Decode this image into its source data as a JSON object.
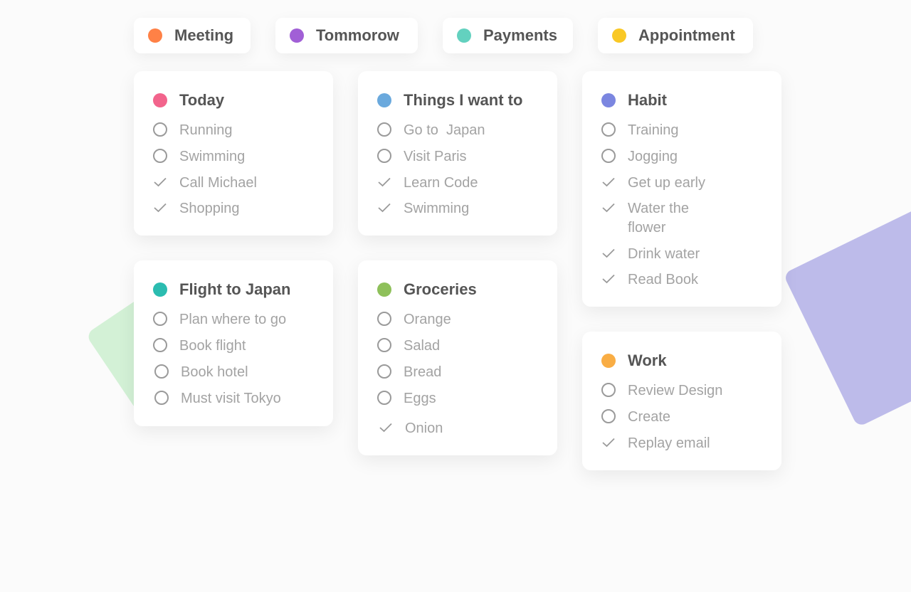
{
  "colors": {
    "orange": "#ff8146",
    "purple": "#a15fd6",
    "teal": "#63d1bf",
    "yellow": "#f9c825",
    "pink": "#f2648c",
    "blue": "#6aa9dd",
    "indigo": "#7b86e0",
    "cyan": "#2bbcb0",
    "green": "#8ec05a",
    "amber": "#f9ad44",
    "deco_green": "#d3f1d6",
    "deco_purple": "#bdbbea"
  },
  "tags": [
    {
      "label": "Meeting"
    },
    {
      "label": "Tommorow"
    },
    {
      "label": "Payments"
    },
    {
      "label": "Appointment"
    }
  ],
  "lists": {
    "today": {
      "title": "Today",
      "items": [
        {
          "text": "Running",
          "done": false
        },
        {
          "text": "Swimming",
          "done": false
        },
        {
          "text": "Call Michael",
          "done": true
        },
        {
          "text": "Shopping",
          "done": true
        }
      ]
    },
    "things": {
      "title": "Things I want to",
      "items": [
        {
          "text": "Go to  Japan",
          "done": false
        },
        {
          "text": "Visit Paris",
          "done": false
        },
        {
          "text": "Learn Code",
          "done": true
        },
        {
          "text": "Swimming",
          "done": true
        }
      ]
    },
    "habit": {
      "title": "Habit",
      "items": [
        {
          "text": "Training",
          "done": false
        },
        {
          "text": "Jogging",
          "done": false
        },
        {
          "text": "Get up early",
          "done": true
        },
        {
          "text": "Water the flower",
          "done": true
        },
        {
          "text": "Drink water",
          "done": true
        },
        {
          "text": "Read Book",
          "done": true
        }
      ]
    },
    "flight": {
      "title": "Flight to Japan",
      "items": [
        {
          "text": "Plan where to go",
          "done": false
        },
        {
          "text": "Book flight",
          "done": false
        },
        {
          "text": "Book hotel",
          "done": false
        },
        {
          "text": "Must visit Tokyo",
          "done": false
        }
      ]
    },
    "groceries": {
      "title": "Groceries",
      "items": [
        {
          "text": "Orange",
          "done": false
        },
        {
          "text": "Salad",
          "done": false
        },
        {
          "text": "Bread",
          "done": false
        },
        {
          "text": "Eggs",
          "done": false
        },
        {
          "text": "Onion",
          "done": true
        }
      ]
    },
    "work": {
      "title": "Work",
      "items": [
        {
          "text": "Review Design",
          "done": false
        },
        {
          "text": "Create",
          "done": false
        },
        {
          "text": "Replay email",
          "done": true
        }
      ]
    }
  }
}
